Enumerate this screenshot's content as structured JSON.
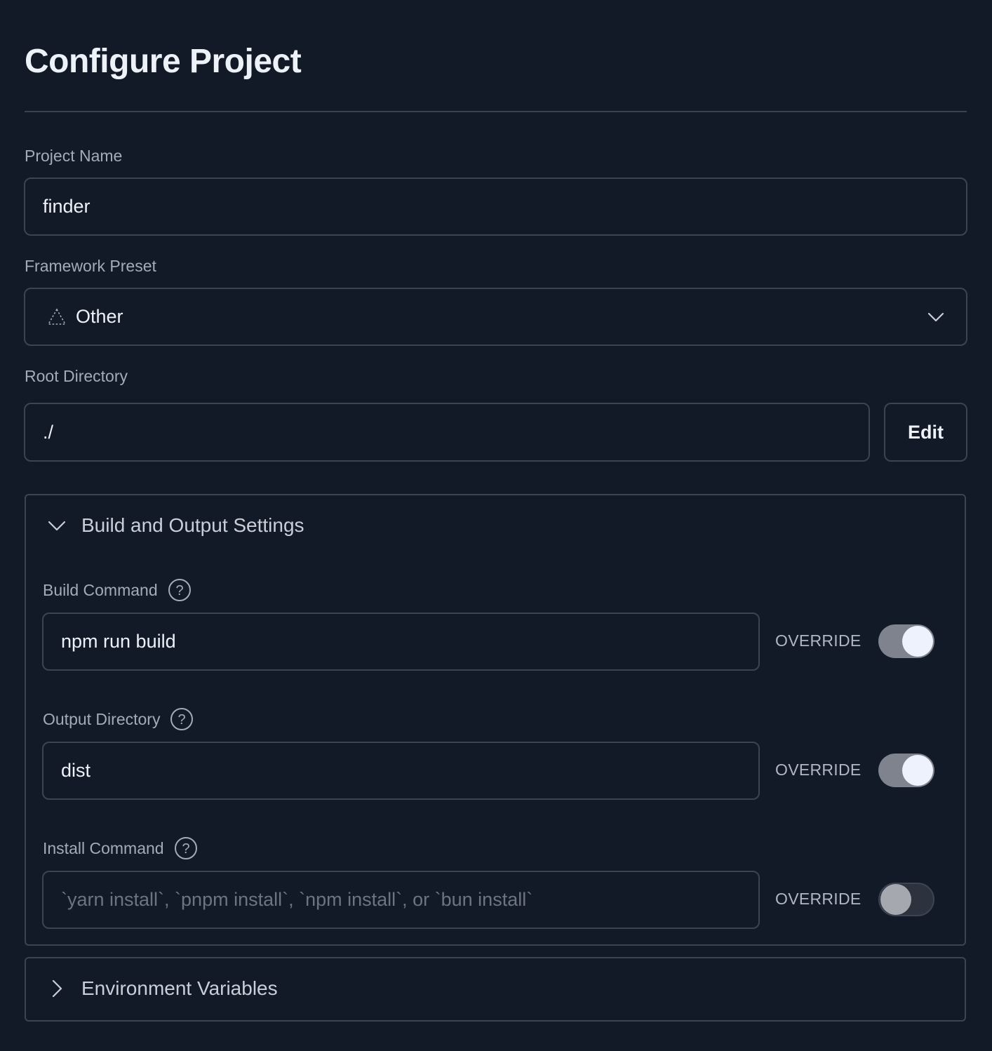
{
  "page": {
    "title": "Configure Project"
  },
  "project_name": {
    "label": "Project Name",
    "value": "finder"
  },
  "framework_preset": {
    "label": "Framework Preset",
    "selected": "Other",
    "icon": "framework-triangle-icon"
  },
  "root_directory": {
    "label": "Root Directory",
    "value": "./",
    "edit_label": "Edit"
  },
  "build_settings": {
    "header": "Build and Output Settings",
    "expanded": true,
    "build_command": {
      "label": "Build Command",
      "value": "npm run build",
      "override_label": "OVERRIDE",
      "override_enabled": true
    },
    "output_directory": {
      "label": "Output Directory",
      "value": "dist",
      "override_label": "OVERRIDE",
      "override_enabled": true
    },
    "install_command": {
      "label": "Install Command",
      "value": "",
      "placeholder": "`yarn install`, `pnpm install`, `npm install`, or `bun install`",
      "override_label": "OVERRIDE",
      "override_enabled": false
    }
  },
  "environment_variables": {
    "header": "Environment Variables",
    "expanded": false
  },
  "colors": {
    "background": "#131a27",
    "border": "#3c4454",
    "text": "#edf1f8",
    "muted_text": "#a4abb8",
    "toggle_on": "#7e838d",
    "toggle_off": "#2c333f"
  }
}
